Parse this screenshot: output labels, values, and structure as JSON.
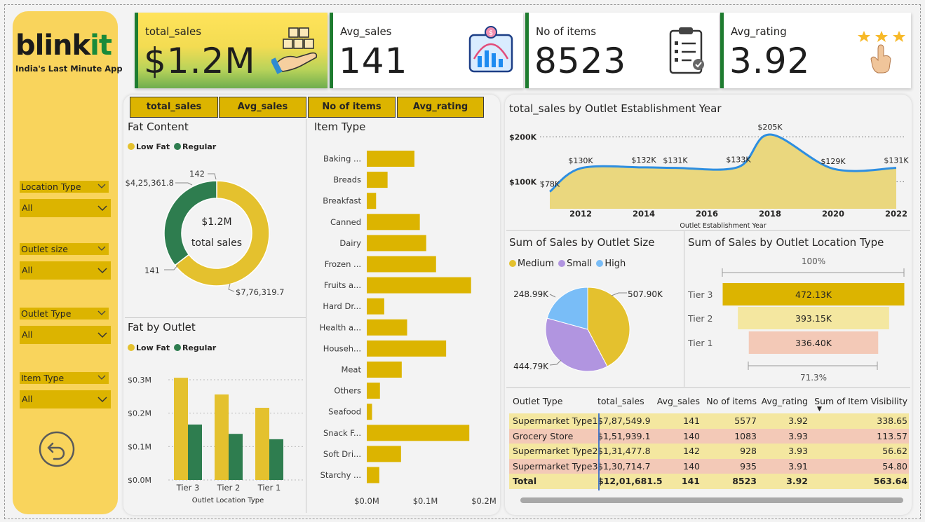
{
  "brand": {
    "logo_part1": "blink",
    "logo_part2": "it",
    "tagline": "India's Last Minute App"
  },
  "colors": {
    "yellow": "#dcb400",
    "green": "#2e7d4f",
    "accent_blue": "#2e8ee0"
  },
  "sidebar": {
    "slicers": [
      {
        "title": "Location Type",
        "value": "All"
      },
      {
        "title": "Outlet size",
        "value": "All"
      },
      {
        "title": "Outlet Type",
        "value": "All"
      },
      {
        "title": "Item Type",
        "value": "All"
      }
    ],
    "back_icon": "undo-arrow-icon"
  },
  "kpis": [
    {
      "label": "total_sales",
      "value": "$1.2M",
      "icon": "hand-boxes-icon"
    },
    {
      "label": "Avg_sales",
      "value": "141",
      "icon": "chart-monitor-icon"
    },
    {
      "label": "No of items",
      "value": "8523",
      "icon": "clipboard-checklist-icon"
    },
    {
      "label": "Avg_rating",
      "value": "3.92",
      "icon": "stars-hand-icon"
    }
  ],
  "tabs": [
    "total_sales",
    "Avg_sales",
    "No of items",
    "Avg_rating"
  ],
  "fat_content": {
    "title": "Fat Content",
    "legend": [
      "Low Fat",
      "Regular"
    ],
    "center_value": "$1.2M",
    "center_label": "total  sales",
    "labels": {
      "regular_value": "$4,25,361.8",
      "regular_count": "142",
      "low_count": "141",
      "low_value": "$7,76,319.7"
    }
  },
  "fat_by_outlet": {
    "title": "Fat by Outlet",
    "legend": [
      "Low Fat",
      "Regular"
    ],
    "xlabel": "Outlet Location Type",
    "yticks": [
      "$0.3M",
      "$0.2M",
      "$0.1M",
      "$0.0M"
    ]
  },
  "item_type": {
    "title": "Item Type",
    "xticks": [
      "$0.0M",
      "$0.1M",
      "$0.2M"
    ]
  },
  "establishment": {
    "title": "total_sales by Outlet Establishment Year",
    "xlabel": "Outlet Establishment Year",
    "yticks": [
      "$200K",
      "$100K"
    ]
  },
  "outlet_size": {
    "title": "Sum of Sales by Outlet Size",
    "legend": [
      "Medium",
      "Small",
      "High"
    ]
  },
  "location_type": {
    "title": "Sum of Sales by Outlet Location Type",
    "top_pct": "100%",
    "bottom_pct": "71.3%"
  },
  "outlet_table": {
    "headers": [
      "Outlet Type",
      "total_sales",
      "Avg_sales",
      "No of items",
      "Avg_rating",
      "Sum of Item Visibility"
    ],
    "rows": [
      [
        "Supermarket Type1",
        "$7,87,549.9",
        "141",
        "5577",
        "3.92",
        "338.65"
      ],
      [
        "Grocery Store",
        "$1,51,939.1",
        "140",
        "1083",
        "3.93",
        "113.57"
      ],
      [
        "Supermarket Type2",
        "$1,31,477.8",
        "142",
        "928",
        "3.93",
        "56.62"
      ],
      [
        "Supermarket Type3",
        "$1,30,714.7",
        "140",
        "935",
        "3.91",
        "54.80"
      ]
    ],
    "total": [
      "Total",
      "$12,01,681.5",
      "141",
      "8523",
      "3.92",
      "563.64"
    ],
    "row_colors": [
      "#f4e7a0",
      "#f3c9b7",
      "#f4e7a0",
      "#f3c9b7"
    ],
    "total_color": "#f4e7a0"
  },
  "chart_data": [
    {
      "type": "pie",
      "title": "Fat Content",
      "categories": [
        "Low Fat",
        "Regular"
      ],
      "values": [
        776319.7,
        425361.8
      ],
      "counts": [
        141,
        142
      ],
      "colors": [
        "#e4c12e",
        "#2e7d4f"
      ]
    },
    {
      "type": "bar",
      "title": "Fat by Outlet",
      "categories": [
        "Tier 3",
        "Tier 2",
        "Tier 1"
      ],
      "series": [
        {
          "name": "Low Fat",
          "values": [
            0.306,
            0.256,
            0.216
          ]
        },
        {
          "name": "Regular",
          "values": [
            0.166,
            0.138,
            0.122
          ]
        }
      ],
      "ylim": [
        0,
        0.35
      ],
      "colors": [
        "#e4c12e",
        "#2e7d4f"
      ]
    },
    {
      "type": "bar",
      "title": "Item Type",
      "orientation": "horizontal",
      "categories": [
        "Baking ...",
        "Breads",
        "Breakfast",
        "Canned",
        "Dairy",
        "Frozen ...",
        "Fruits a...",
        "Hard Dr...",
        "Health a...",
        "Househ...",
        "Meat",
        "Others",
        "Seafood",
        "Snack F...",
        "Soft Dri...",
        "Starchy ..."
      ],
      "values": [
        0.0814,
        0.0355,
        0.0159,
        0.0906,
        0.1015,
        0.1183,
        0.1781,
        0.0298,
        0.0689,
        0.1355,
        0.0597,
        0.0225,
        0.009,
        0.1751,
        0.0585,
        0.0214
      ],
      "xlim": [
        0,
        0.2
      ],
      "color": "#dcb400"
    },
    {
      "type": "area",
      "title": "total_sales by Outlet Establishment Year",
      "x": [
        2011,
        2012,
        2014,
        2015,
        2017,
        2018,
        2020,
        2022
      ],
      "values": [
        78,
        130,
        132,
        131,
        133,
        205,
        129,
        131
      ],
      "labels": [
        "$78K",
        "$130K",
        "$132K",
        "$131K",
        "$133K",
        "$205K",
        "$129K",
        "$131K"
      ],
      "xticks": [
        2012,
        2014,
        2016,
        2018,
        2020,
        2022
      ],
      "ylim": [
        40,
        230
      ],
      "line_color": "#2e8ee0",
      "fill_color": "#ead77e"
    },
    {
      "type": "pie",
      "title": "Sum of Sales by Outlet Size",
      "categories": [
        "Medium",
        "Small",
        "High"
      ],
      "values": [
        507.9,
        444.79,
        248.99
      ],
      "labels": [
        "507.90K",
        "444.79K",
        "248.99K"
      ],
      "colors": [
        "#e4c12e",
        "#b195e0",
        "#79bdf7"
      ]
    },
    {
      "type": "bar",
      "title": "Sum of Sales by Outlet Location Type",
      "orientation": "funnel",
      "categories": [
        "Tier 3",
        "Tier 2",
        "Tier 1"
      ],
      "values": [
        472.13,
        393.15,
        336.4
      ],
      "labels": [
        "472.13K",
        "393.15K",
        "336.40K"
      ],
      "colors": [
        "#dcb400",
        "#f4e7a0",
        "#f3c9b7"
      ]
    }
  ]
}
